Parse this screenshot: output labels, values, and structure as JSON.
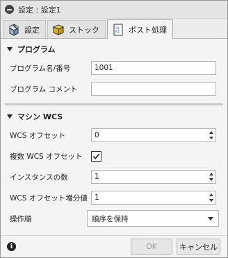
{
  "window": {
    "title": "設定 : 設定1"
  },
  "tabs": [
    {
      "label": "設定",
      "icon": "tool-settings-icon"
    },
    {
      "label": "ストック",
      "icon": "stock-box-icon"
    },
    {
      "label": "ポスト処理",
      "icon": "post-process-icon",
      "active": true
    }
  ],
  "program_section": {
    "title": "プログラム",
    "program_name_label": "プログラム名/番号",
    "program_name_value": "1001",
    "program_comment_label": "プログラム コメント",
    "program_comment_value": ""
  },
  "wcs_section": {
    "title": "マシン WCS",
    "wcs_offset_label": "WCS オフセット",
    "wcs_offset_value": "0",
    "multiple_wcs_label": "複数 WCS オフセット",
    "multiple_wcs_checked": true,
    "instances_label": "インスタンスの数",
    "instances_value": "1",
    "wcs_increment_label": "WCS オフセット増分値",
    "wcs_increment_value": "1",
    "operation_order_label": "操作順",
    "operation_order_value": "順序を保持"
  },
  "footer": {
    "ok_label": "OK",
    "cancel_label": "キャンセル"
  }
}
